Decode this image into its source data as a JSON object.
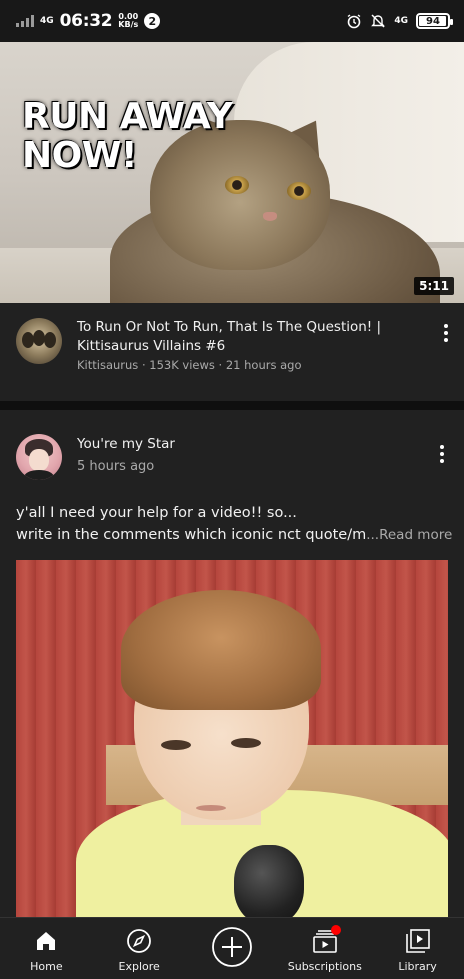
{
  "status_bar": {
    "network_left": "4G",
    "time": "06:32",
    "speed_value": "0.00",
    "speed_unit": "KB/s",
    "notification_count": "2",
    "network_right": "4G",
    "battery": "94",
    "icons": [
      "signal-icon",
      "alarm-icon",
      "mute-icon",
      "battery-icon"
    ]
  },
  "video": {
    "thumbnail_text": "RUN AWAY NOW!",
    "duration": "5:11",
    "title": "To Run Or Not To Run, That Is The Question! | Kittisaurus Villains #6",
    "subtitle": "Kittisaurus · 153K views · 21 hours ago"
  },
  "post": {
    "author": "You're my Star",
    "time": "5 hours ago",
    "text_line1": "y'all I need your help for a video!! so...",
    "text_line2": "write in the comments which iconic nct quote/m",
    "read_more": "...Read more"
  },
  "bottom_nav": {
    "items": [
      {
        "label": "Home",
        "icon": "home-icon"
      },
      {
        "label": "Explore",
        "icon": "explore-icon"
      },
      {
        "label": "",
        "icon": "create-icon"
      },
      {
        "label": "Subscriptions",
        "icon": "subscriptions-icon"
      },
      {
        "label": "Library",
        "icon": "library-icon"
      }
    ]
  },
  "colors": {
    "background": "#212121",
    "status_bar": "#181818",
    "secondary_text": "#aaaaaa",
    "notification_dot": "#ff0000"
  }
}
